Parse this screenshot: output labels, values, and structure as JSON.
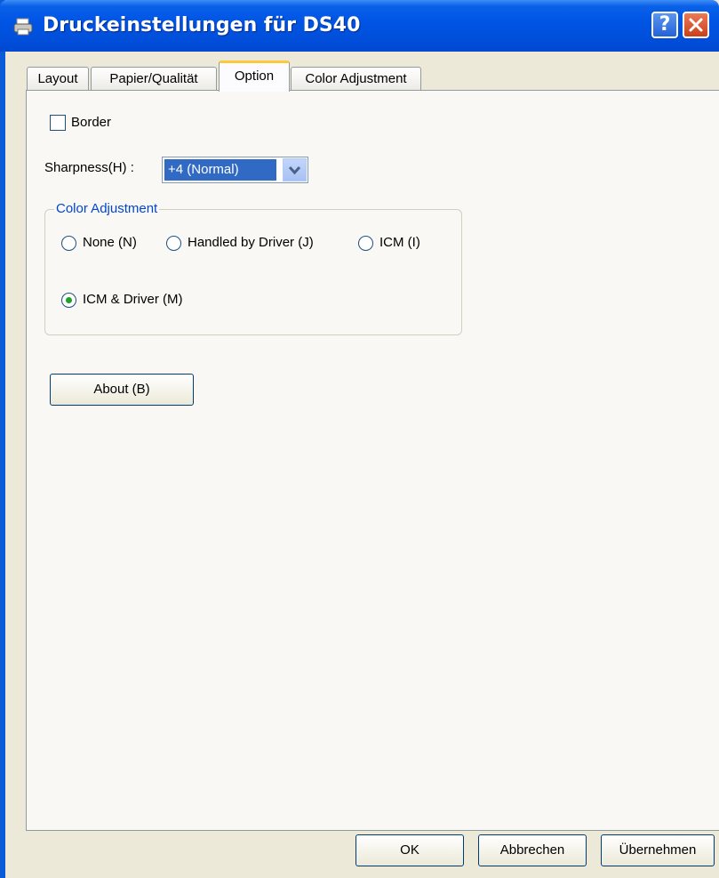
{
  "window": {
    "title": "Druckeinstellungen für DS40",
    "help_label": "?",
    "close_label": "X"
  },
  "tabs": [
    {
      "label": "Layout"
    },
    {
      "label": "Papier/Qualität"
    },
    {
      "label": "Option",
      "active": true
    },
    {
      "label": "Color Adjustment"
    }
  ],
  "option": {
    "border_label": "Border",
    "border_checked": false,
    "sharpness_label": "Sharpness(H) :",
    "sharpness_value": "+4 (Normal)",
    "color_group": {
      "legend": "Color Adjustment",
      "options": [
        {
          "label": "None (N)",
          "selected": false
        },
        {
          "label": "Handled by Driver (J)",
          "selected": false
        },
        {
          "label": "ICM (I)",
          "selected": false
        },
        {
          "label": "ICM  & Driver (M)",
          "selected": true
        }
      ]
    },
    "about_label": "About (B)"
  },
  "footer": {
    "ok_label": "OK",
    "cancel_label": "Abbrechen",
    "apply_label": "Übernehmen"
  },
  "colors": {
    "titlebar": "#0055e5",
    "background": "#ece9d8",
    "panel": "#f9f8f4",
    "active_tab_accent": "#ffc83c",
    "group_legend": "#0046d5",
    "selection": "#316ac5"
  },
  "icons": {
    "title": "printer-icon",
    "dropdown": "chevron-down-icon"
  }
}
